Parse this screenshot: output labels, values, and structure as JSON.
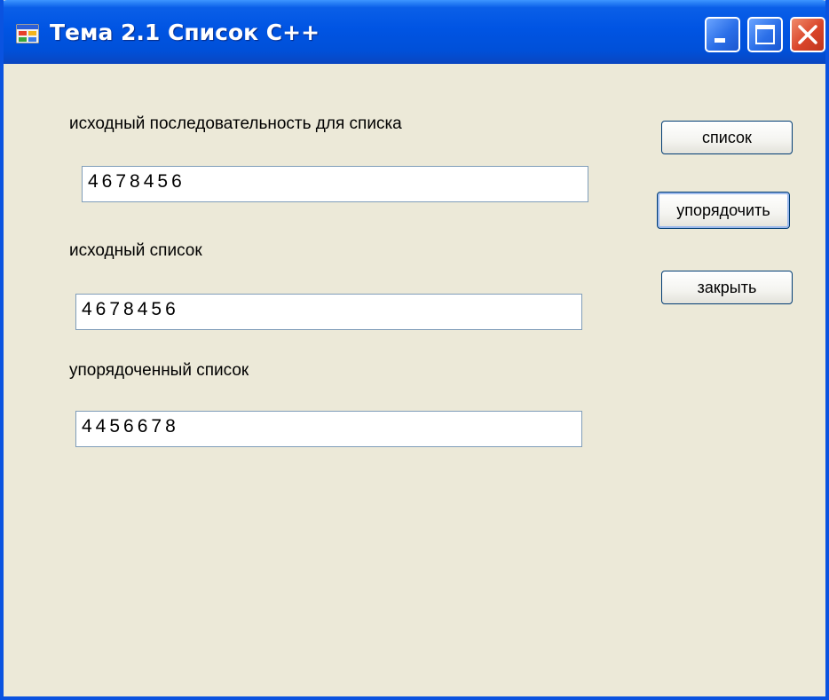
{
  "window": {
    "title": "Тема 2.1 Список С++",
    "icon": "windows-form-icon",
    "controls": [
      "minimize-icon",
      "maximize-icon",
      "close-icon"
    ]
  },
  "form": {
    "input_label": "исходный последовательность для списка",
    "input_value": "4678456",
    "source_label": "исходный список",
    "source_value": "4678456",
    "sorted_label": "упорядоченный список",
    "sorted_value": "4456678"
  },
  "buttons": {
    "list": "список",
    "sort": "упорядочить",
    "close": "закрыть"
  },
  "colors": {
    "titlebar": "#0054e3",
    "form_background": "#ece9d8",
    "close_button": "#d9452a"
  }
}
